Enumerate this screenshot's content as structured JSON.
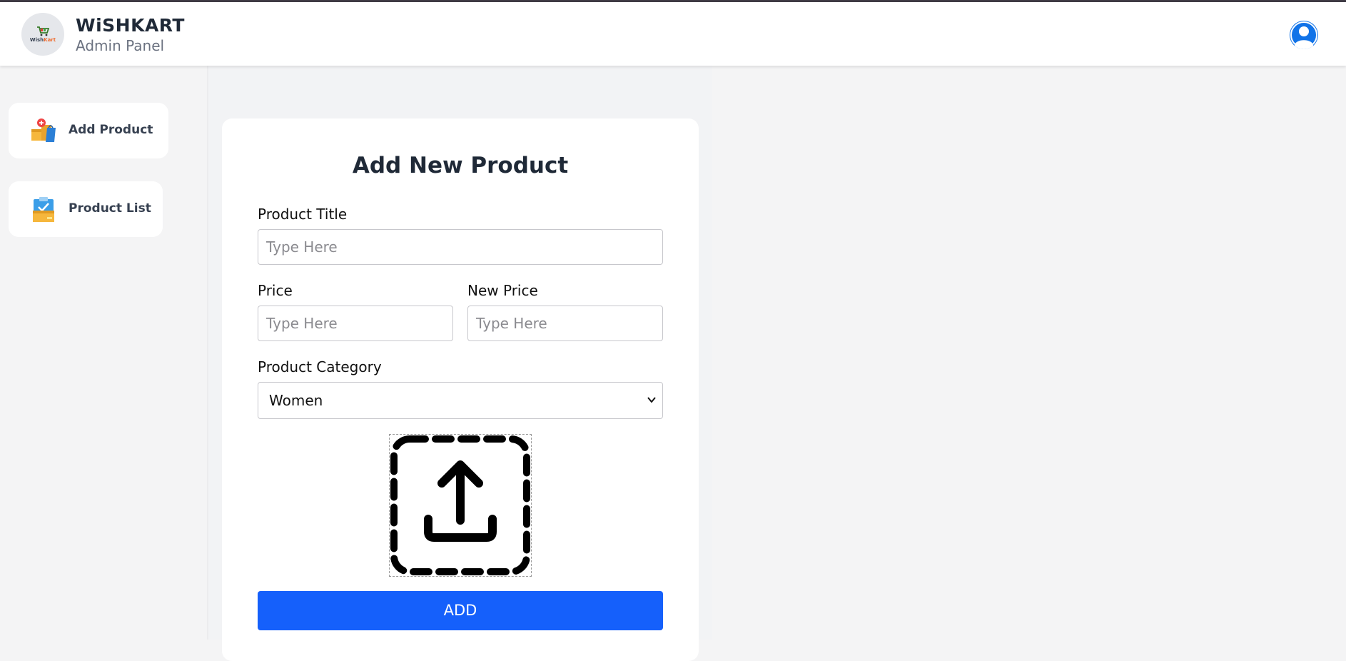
{
  "header": {
    "logo_text_a": "Wish",
    "logo_text_b": "Kart",
    "brand": "WiSHKART",
    "subtitle": "Admin Panel",
    "profile_icon": "user-circle-icon"
  },
  "sidebar": {
    "items": [
      {
        "label": "Add Product",
        "icon": "add-product-icon"
      },
      {
        "label": "Product List",
        "icon": "product-list-icon"
      }
    ]
  },
  "form": {
    "title": "Add New Product",
    "product_title_label": "Product Title",
    "product_title_placeholder": "Type Here",
    "price_label": "Price",
    "price_placeholder": "Type Here",
    "new_price_label": "New Price",
    "new_price_placeholder": "Type Here",
    "category_label": "Product Category",
    "category_value": "Women",
    "upload_icon": "upload-icon",
    "add_button": "ADD"
  },
  "colors": {
    "accent": "#1560fb",
    "profile": "#1173e8",
    "logo_orange": "#ef6c2f"
  }
}
